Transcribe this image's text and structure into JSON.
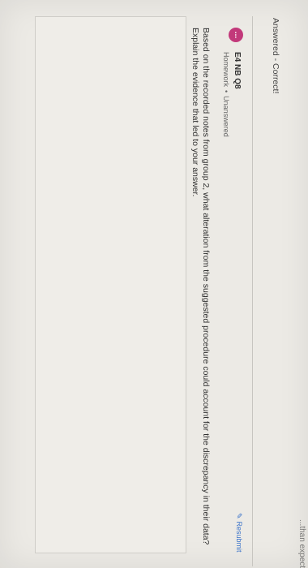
{
  "previous": {
    "tail_text": "...than expected.",
    "status": "Answered - Correct!"
  },
  "question": {
    "avatar": "...",
    "title": "E4 NB Q8",
    "type": "Homework",
    "separator": "•",
    "state": "Unanswered",
    "text": "Based on the recorded notes from group 2, what alteration from the suggested procedure could account for the discrepancy in their data? Explain the evidence that led to your answer.",
    "resubmit": "Resubmit"
  },
  "answer_box": {
    "value": ""
  },
  "icons": {
    "resubmit": "pencil-icon",
    "avatar": "dots-avatar-icon"
  },
  "colors": {
    "avatar_bg": "#c2397a",
    "link": "#3b73c9"
  }
}
